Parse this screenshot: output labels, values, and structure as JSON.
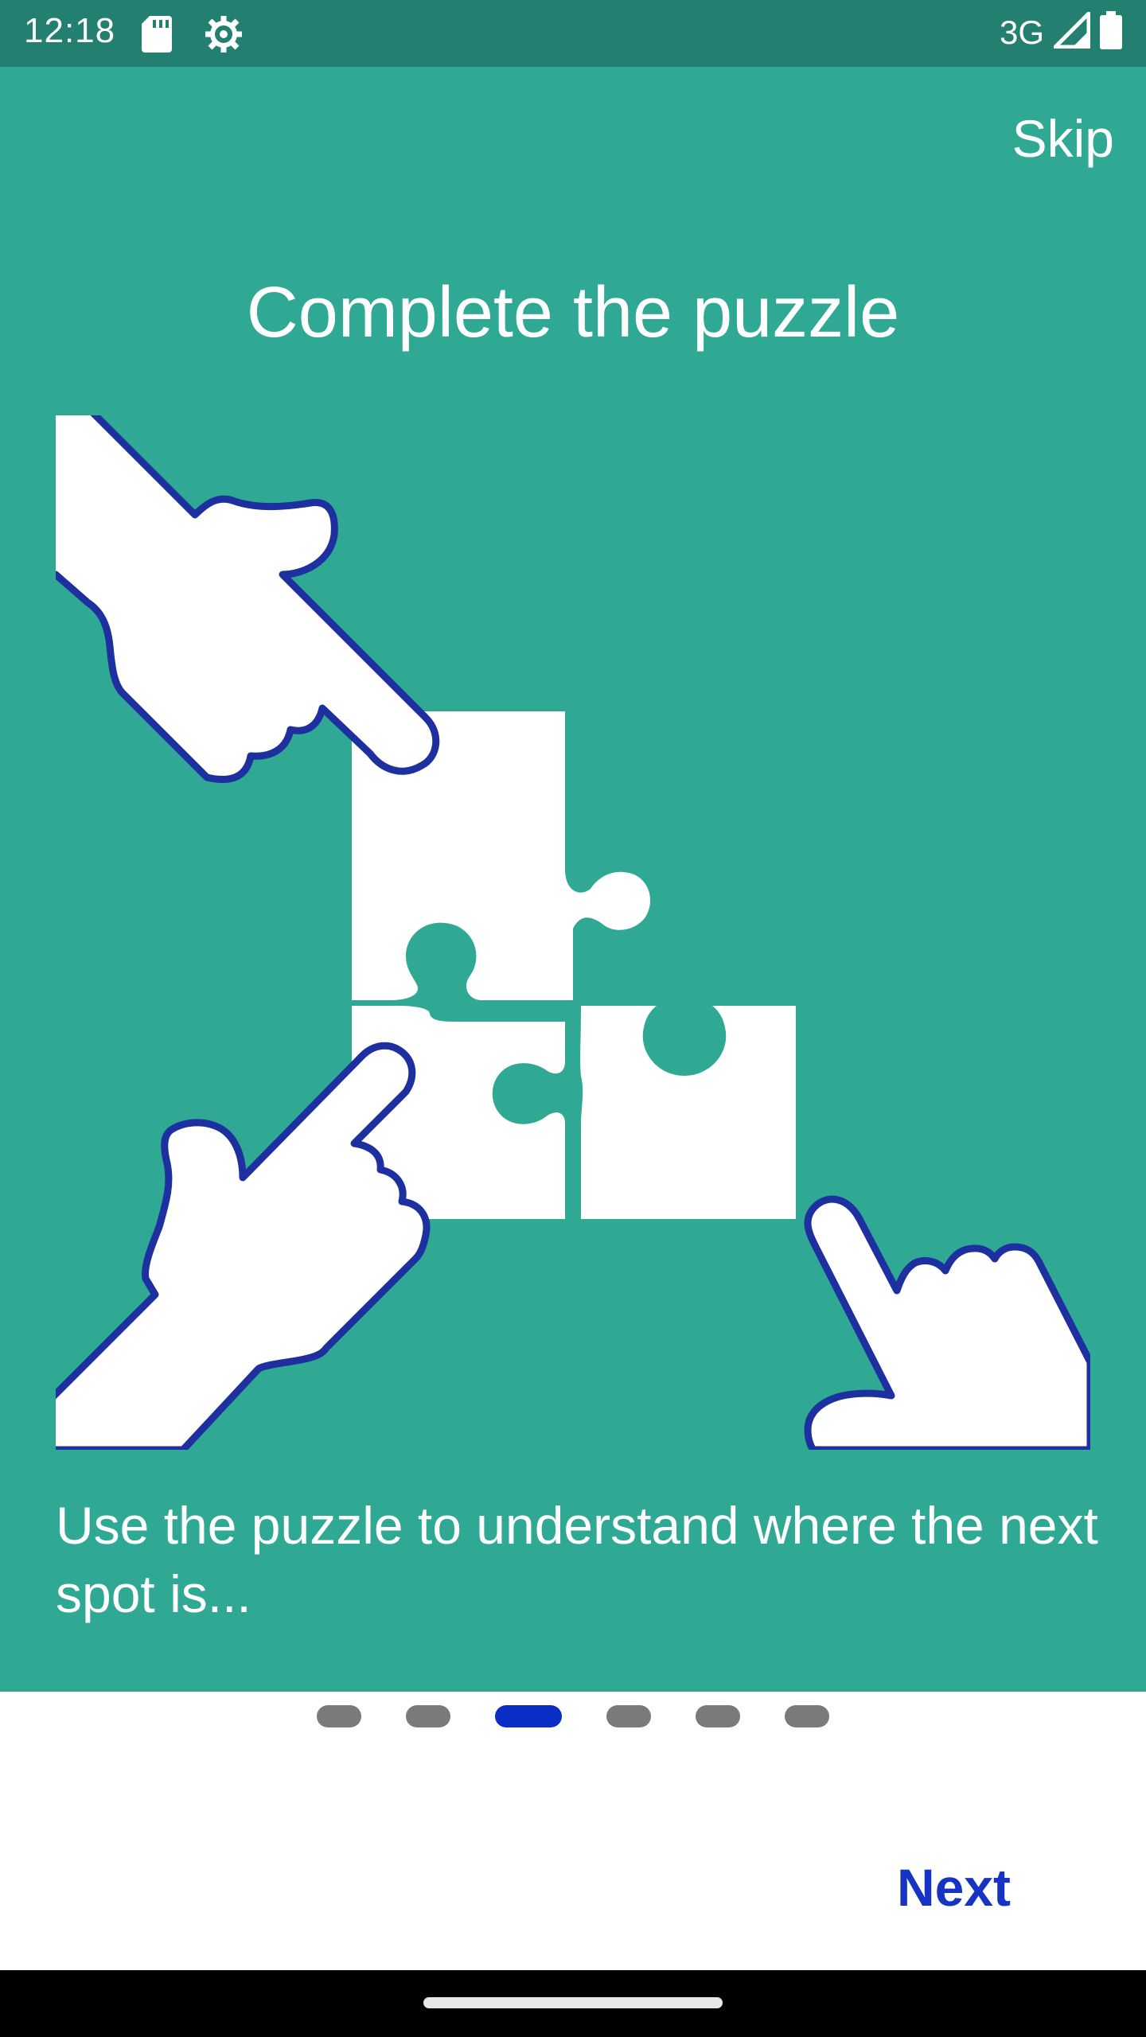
{
  "status_bar": {
    "time": "12:18",
    "network": "3G",
    "icons": [
      "sd-card-icon",
      "settings-icon",
      "signal-icon",
      "battery-icon"
    ]
  },
  "onboarding": {
    "skip_label": "Skip",
    "title": "Complete the puzzle",
    "illustration": "hands-assembling-puzzle",
    "description": "Use the puzzle to understand where the next spot is...",
    "page_indicator": {
      "total": 6,
      "current": 3
    },
    "next_label": "Next"
  },
  "colors": {
    "background": "#2fa994",
    "status_bar": "#238070",
    "outline": "#1e2fa0",
    "accent": "#1633c4",
    "dot_inactive": "#7a7a7a",
    "dot_active": "#0b2fc6"
  }
}
